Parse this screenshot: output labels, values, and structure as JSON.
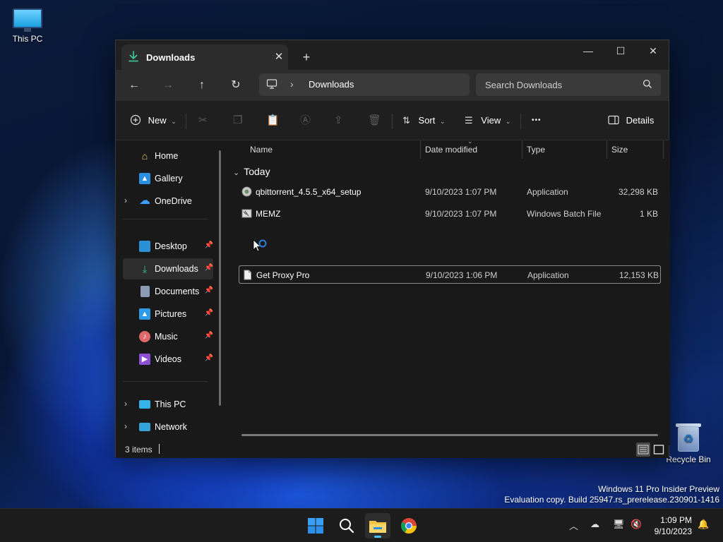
{
  "desktop": {
    "icons": [
      {
        "label": "This PC"
      },
      {
        "label": "Recycle Bin"
      }
    ],
    "watermark": {
      "line1": "Windows 11 Pro Insider Preview",
      "line2": "Evaluation copy. Build 25947.rs_prerelease.230901-1416"
    }
  },
  "window": {
    "tab": {
      "label": "Downloads",
      "close": "✕",
      "new_tab": "+"
    },
    "controls": {
      "minimize": "—",
      "maximize": "☐",
      "close": "✕"
    },
    "nav": {
      "back": "←",
      "forward": "→",
      "up": "↑",
      "refresh": "↻"
    },
    "address": {
      "separator": "›",
      "crumb": "Downloads"
    },
    "search": {
      "placeholder": "Search Downloads"
    },
    "commands": {
      "new": "New",
      "sort": "Sort",
      "view": "View",
      "more": "•••",
      "details": "Details"
    },
    "sidebar": {
      "items": [
        {
          "label": "Home"
        },
        {
          "label": "Gallery"
        },
        {
          "label": "OneDrive"
        },
        {
          "label": "Desktop"
        },
        {
          "label": "Downloads"
        },
        {
          "label": "Documents"
        },
        {
          "label": "Pictures"
        },
        {
          "label": "Music"
        },
        {
          "label": "Videos"
        },
        {
          "label": "This PC"
        },
        {
          "label": "Network"
        }
      ]
    },
    "columns": {
      "name": "Name",
      "date": "Date modified",
      "type": "Type",
      "size": "Size"
    },
    "group": "Today",
    "files": [
      {
        "name": "qbittorrent_4.5.5_x64_setup",
        "date": "9/10/2023 1:07 PM",
        "type": "Application",
        "size": "32,298 KB"
      },
      {
        "name": "MEMZ",
        "date": "9/10/2023 1:07 PM",
        "type": "Windows Batch File",
        "size": "1 KB"
      },
      {
        "name": "Get Proxy Pro",
        "date": "9/10/2023 1:06 PM",
        "type": "Application",
        "size": "12,153 KB"
      }
    ],
    "status": {
      "count": "3 items"
    }
  },
  "taskbar": {
    "clock": {
      "time": "1:09 PM",
      "date": "9/10/2023"
    }
  },
  "colors": {
    "accent": "#4cc2ff",
    "downloads_green": "#39c29b",
    "window_bg": "#191919",
    "chrome_bg": "#2c2c2c"
  },
  "icons": [
    "monitor-icon",
    "recycle-bin-icon",
    "download-arrow-icon",
    "search-icon",
    "home-icon",
    "gallery-icon",
    "onedrive-icon",
    "desktop-icon",
    "documents-icon",
    "pictures-icon",
    "music-icon",
    "videos-icon",
    "network-icon",
    "pin-icon",
    "windows-start-icon",
    "file-explorer-icon",
    "chrome-icon",
    "bell-icon"
  ]
}
